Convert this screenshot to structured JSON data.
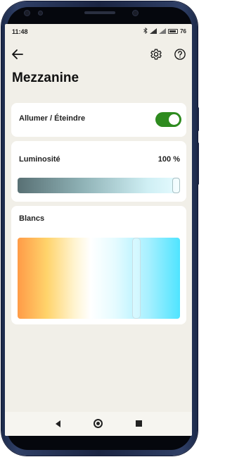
{
  "status_bar": {
    "time": "11:48",
    "battery": "76",
    "icons": [
      "bluetooth-icon",
      "signal-icon",
      "wifi-icon",
      "battery-icon"
    ]
  },
  "header": {
    "title": "Mezzanine",
    "icons": [
      "back-arrow-icon",
      "gear-icon",
      "help-icon"
    ]
  },
  "power": {
    "label": "Allumer / Éteindre",
    "on": true,
    "accent_color": "#2e8b1f"
  },
  "brightness": {
    "label": "Luminosité",
    "value_text": "100 %",
    "value_fraction": 1.0
  },
  "whites": {
    "label": "Blancs",
    "value_fraction": 0.73
  },
  "nav": {
    "icons": [
      "nav-back-icon",
      "nav-home-icon",
      "nav-recents-icon"
    ]
  }
}
